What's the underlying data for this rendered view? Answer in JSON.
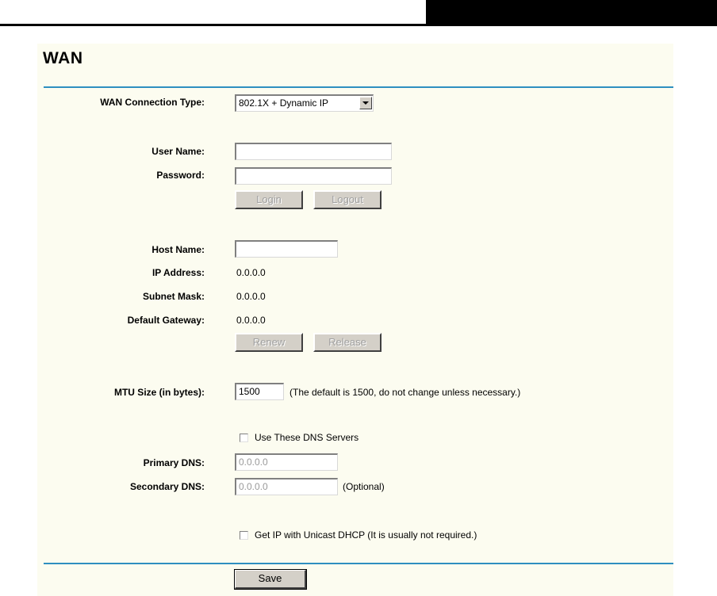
{
  "page": {
    "title": "WAN"
  },
  "form": {
    "connection_type": {
      "label": "WAN Connection Type:",
      "value": "802.1X + Dynamic IP"
    },
    "username": {
      "label": "User Name:",
      "value": ""
    },
    "password": {
      "label": "Password:",
      "value": ""
    },
    "login_button": "Login",
    "logout_button": "Logout",
    "hostname": {
      "label": "Host Name:",
      "value": ""
    },
    "ip_address": {
      "label": "IP Address:",
      "value": "0.0.0.0"
    },
    "subnet_mask": {
      "label": "Subnet Mask:",
      "value": "0.0.0.0"
    },
    "default_gateway": {
      "label": "Default Gateway:",
      "value": "0.0.0.0"
    },
    "renew_button": "Renew",
    "release_button": "Release",
    "mtu": {
      "label": "MTU Size (in bytes):",
      "value": "1500",
      "hint": "(The default is 1500, do not change unless necessary.)"
    },
    "use_dns": {
      "label": "Use These DNS Servers",
      "checked": false
    },
    "primary_dns": {
      "label": "Primary DNS:",
      "value": "0.0.0.0"
    },
    "secondary_dns": {
      "label": "Secondary DNS:",
      "value": "0.0.0.0",
      "hint": "(Optional)"
    },
    "unicast_dhcp": {
      "label": "Get IP with Unicast DHCP (It is usually not required.)",
      "checked": false
    },
    "save_button": "Save"
  },
  "colors": {
    "accent_line": "#2e8fc0",
    "panel_bg": "#fcfcf0"
  }
}
